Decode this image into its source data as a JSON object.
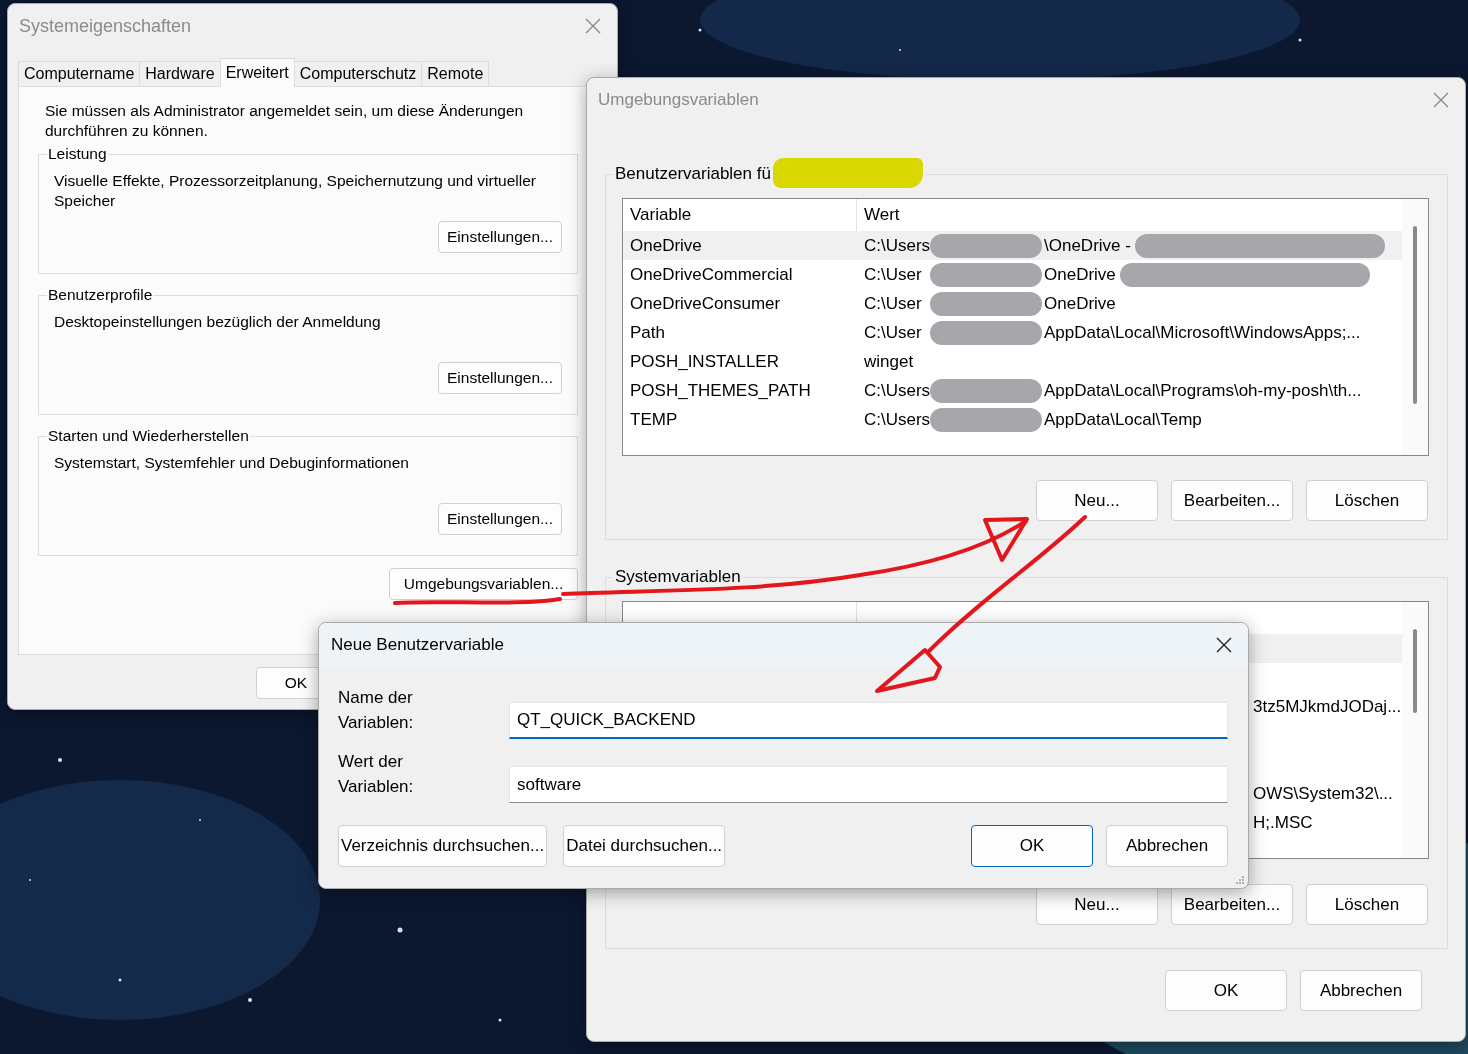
{
  "system_properties": {
    "title": "Systemeigenschaften",
    "tabs": [
      {
        "label": "Computername",
        "selected": false
      },
      {
        "label": "Hardware",
        "selected": false
      },
      {
        "label": "Erweitert",
        "selected": true
      },
      {
        "label": "Computerschutz",
        "selected": false
      },
      {
        "label": "Remote",
        "selected": false
      }
    ],
    "notice": "Sie müssen als Administrator angemeldet sein, um diese Änderungen durchführen zu können.",
    "groups": [
      {
        "title": "Leistung",
        "description": "Visuelle Effekte, Prozessorzeitplanung, Speichernutzung und virtueller Speicher",
        "button": "Einstellungen..."
      },
      {
        "title": "Benutzerprofile",
        "description": "Desktopeinstellungen bezüglich der Anmeldung",
        "button": "Einstellungen..."
      },
      {
        "title": "Starten und Wiederherstellen",
        "description": "Systemstart, Systemfehler und Debuginformationen",
        "button": "Einstellungen..."
      }
    ],
    "environment_button": "Umgebungsvariablen...",
    "buttons": [
      "OK"
    ]
  },
  "environment_variables": {
    "title": "Umgebungsvariablen",
    "user_variables": {
      "title": "Benutzervariablen fü",
      "highlighted": true,
      "columns": [
        "Variable",
        "Wert"
      ],
      "rows": [
        {
          "name": "OneDrive",
          "value_start": "C:\\Users",
          "redacted": true,
          "value_end": "\\OneDrive -",
          "trailing_redacted": true,
          "selected": true
        },
        {
          "name": "OneDriveCommercial",
          "value_start": "C:\\User",
          "redacted": true,
          "value_end": "OneDrive",
          "trailing_redacted": true,
          "selected": false
        },
        {
          "name": "OneDriveConsumer",
          "value_start": "C:\\User",
          "redacted": true,
          "value_end": "OneDrive",
          "trailing_redacted": false,
          "selected": false
        },
        {
          "name": "Path",
          "value_start": "C:\\User",
          "redacted": true,
          "value_end": "AppData\\Local\\Microsoft\\WindowsApps;...",
          "trailing_redacted": false,
          "selected": false
        },
        {
          "name": "POSH_INSTALLER",
          "value_start": "winget",
          "redacted": false,
          "value_end": "",
          "trailing_redacted": false,
          "selected": false
        },
        {
          "name": "POSH_THEMES_PATH",
          "value_start": "C:\\Users",
          "redacted": true,
          "value_end": "AppData\\Local\\Programs\\oh-my-posh\\th...",
          "trailing_redacted": false,
          "selected": false
        },
        {
          "name": "TEMP",
          "value_start": "C:\\Users",
          "redacted": true,
          "value_end": "AppData\\Local\\Temp",
          "trailing_redacted": false,
          "selected": false
        }
      ],
      "buttons": [
        "Neu...",
        "Bearbeiten...",
        "Löschen"
      ]
    },
    "system_variables": {
      "title": "Systemvariablen",
      "rows": [
        {
          "value": "",
          "selected": true
        },
        {
          "value": "",
          "selected": false
        },
        {
          "value": "3tz5MJkmdJODaj...",
          "selected": false
        },
        {
          "value": "",
          "selected": false
        },
        {
          "value": "",
          "selected": false
        },
        {
          "value": "OWS\\System32\\...",
          "selected": false
        },
        {
          "value": "H;.MSC",
          "selected": false
        }
      ],
      "buttons": [
        "Neu...",
        "Bearbeiten...",
        "Löschen"
      ]
    },
    "buttons": [
      "OK",
      "Abbrechen"
    ]
  },
  "new_variable_dialog": {
    "title": "Neue Benutzervariable",
    "fields": [
      {
        "label_lines": [
          "Name der",
          "Variablen:"
        ],
        "value": "QT_QUICK_BACKEND",
        "focused": true
      },
      {
        "label_lines": [
          "Wert der",
          "Variablen:"
        ],
        "value": "software",
        "focused": false
      }
    ],
    "browse_buttons": [
      {
        "label": "Verzeichnis durchsuchen...",
        "default": false
      },
      {
        "label": "Datei durchsuchen...",
        "default": false
      }
    ],
    "buttons": [
      {
        "label": "OK",
        "default": true
      },
      {
        "label": "Abbrechen",
        "default": false
      }
    ]
  }
}
